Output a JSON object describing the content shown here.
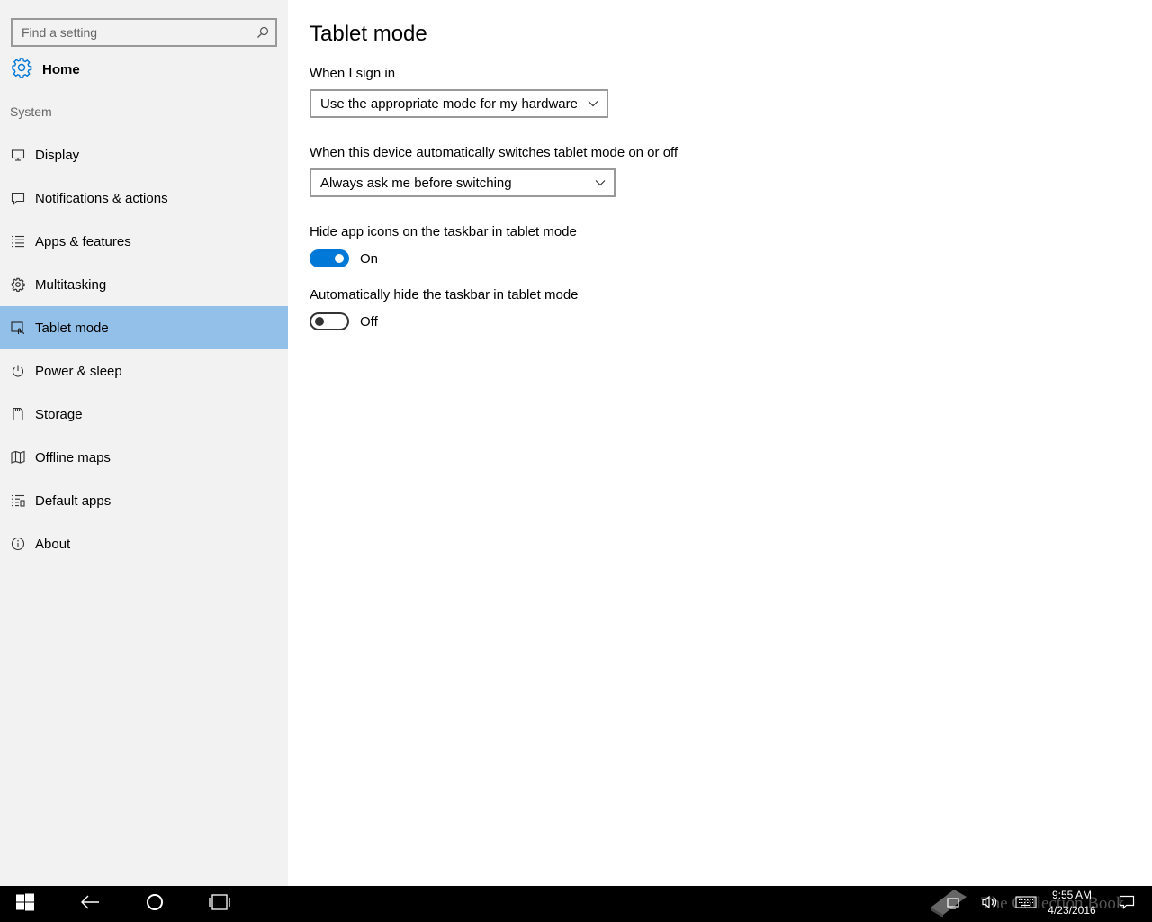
{
  "sidebar": {
    "search": {
      "placeholder": "Find a setting",
      "value": ""
    },
    "home_label": "Home",
    "section_label": "System",
    "items": [
      {
        "label": "Display",
        "icon": "display-icon",
        "selected": false
      },
      {
        "label": "Notifications & actions",
        "icon": "notifications-icon",
        "selected": false
      },
      {
        "label": "Apps & features",
        "icon": "apps-list-icon",
        "selected": false
      },
      {
        "label": "Multitasking",
        "icon": "multitasking-icon",
        "selected": false
      },
      {
        "label": "Tablet mode",
        "icon": "tablet-mode-icon",
        "selected": true
      },
      {
        "label": "Power & sleep",
        "icon": "power-icon",
        "selected": false
      },
      {
        "label": "Storage",
        "icon": "storage-icon",
        "selected": false
      },
      {
        "label": "Offline maps",
        "icon": "map-icon",
        "selected": false
      },
      {
        "label": "Default apps",
        "icon": "default-apps-icon",
        "selected": false
      },
      {
        "label": "About",
        "icon": "info-icon",
        "selected": false
      }
    ]
  },
  "main": {
    "title": "Tablet mode",
    "sign_in": {
      "label": "When I sign in",
      "value": "Use the appropriate mode for my hardware"
    },
    "auto_switch": {
      "label": "When this device automatically switches tablet mode on or off",
      "value": "Always ask me before switching"
    },
    "hide_icons": {
      "label": "Hide app icons on the taskbar in tablet mode",
      "state": "On"
    },
    "hide_taskbar": {
      "label": "Automatically hide the taskbar in tablet mode",
      "state": "Off"
    }
  },
  "taskbar": {
    "time": "9:55 AM",
    "date": "4/23/2016",
    "watermark": "The Collection Book",
    "icons": [
      "windows-start-icon",
      "back-arrow-icon",
      "cortana-circle-icon",
      "task-view-icon",
      "network-icon",
      "volume-icon",
      "keyboard-icon",
      "action-center-icon"
    ]
  },
  "colors": {
    "sidebar_bg": "#f2f2f2",
    "selected_bg": "#92c0e8",
    "accent": "#0078d7",
    "taskbar_bg": "#000000"
  }
}
